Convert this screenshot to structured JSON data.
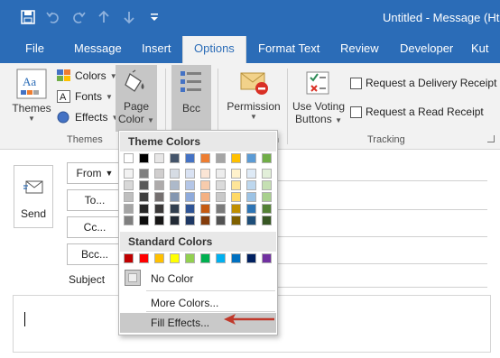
{
  "window": {
    "title": "Untitled  -  Message (Ht",
    "qat_icons": [
      "save-icon",
      "undo-icon",
      "redo-icon",
      "up-icon",
      "down-icon",
      "customize-icon"
    ]
  },
  "tabs": [
    {
      "label": "File"
    },
    {
      "label": "Message"
    },
    {
      "label": "Insert"
    },
    {
      "label": "Options",
      "active": true
    },
    {
      "label": "Format Text"
    },
    {
      "label": "Review"
    },
    {
      "label": "Developer"
    },
    {
      "label": "Kut"
    }
  ],
  "ribbon": {
    "themes": {
      "label": "Themes",
      "group_label": "Themes"
    },
    "colors": {
      "label": "Colors"
    },
    "fonts": {
      "label": "Fonts"
    },
    "effects": {
      "label": "Effects"
    },
    "page_color": {
      "line1": "Page",
      "line2": "Color"
    },
    "bcc": {
      "label": "Bcc"
    },
    "permission": {
      "label": "Permission",
      "group_label_tail": "n"
    },
    "voting": {
      "line1": "Use Voting",
      "line2": "Buttons"
    },
    "delivery_receipt": {
      "label": "Request a Delivery Receipt"
    },
    "read_receipt": {
      "label": "Request a Read Receipt"
    },
    "tracking": {
      "group_label": "Tracking"
    }
  },
  "message": {
    "send": {
      "label": "Send"
    },
    "from": {
      "label": "From"
    },
    "to": {
      "label": "To..."
    },
    "cc": {
      "label": "Cc..."
    },
    "bcc": {
      "label": "Bcc..."
    },
    "subject": {
      "label": "Subject"
    }
  },
  "dropdown": {
    "theme_header": "Theme Colors",
    "standard_header": "Standard Colors",
    "theme_top": [
      "#ffffff",
      "#000000",
      "#e7e6e6",
      "#44546a",
      "#4472c4",
      "#ed7d31",
      "#a5a5a5",
      "#ffc000",
      "#5b9bd5",
      "#70ad47"
    ],
    "theme_shades": [
      [
        "#f2f2f2",
        "#7f7f7f",
        "#d0cece",
        "#d6dce4",
        "#d9e2f3",
        "#fbe5d5",
        "#ededed",
        "#fff2cc",
        "#deeaf6",
        "#e2efd9"
      ],
      [
        "#d8d8d8",
        "#595959",
        "#aeabab",
        "#adb9ca",
        "#b4c6e7",
        "#f7cbac",
        "#dbdbdb",
        "#fee599",
        "#bdd7ee",
        "#c5e0b3"
      ],
      [
        "#bfbfbf",
        "#3f3f3f",
        "#757070",
        "#8496b0",
        "#8eaadb",
        "#f4b183",
        "#c9c9c9",
        "#ffd966",
        "#9cc3e5",
        "#a8d08d"
      ],
      [
        "#a5a5a5",
        "#262626",
        "#3a3838",
        "#323f4f",
        "#2f5496",
        "#c55a11",
        "#7b7b7b",
        "#bf8f00",
        "#2e75b5",
        "#538135"
      ],
      [
        "#7f7f7f",
        "#0c0c0c",
        "#171616",
        "#222a35",
        "#1e3864",
        "#843c0b",
        "#525252",
        "#7f6000",
        "#1e4e79",
        "#375623"
      ]
    ],
    "standard": [
      "#c00000",
      "#ff0000",
      "#ffc000",
      "#ffff00",
      "#92d050",
      "#00b050",
      "#00b0f0",
      "#0070c0",
      "#002060",
      "#7030a0"
    ],
    "no_color": "No Color",
    "more_colors": "More Colors...",
    "fill_effects": "Fill Effects...",
    "arrow_color": "#c0392b"
  }
}
